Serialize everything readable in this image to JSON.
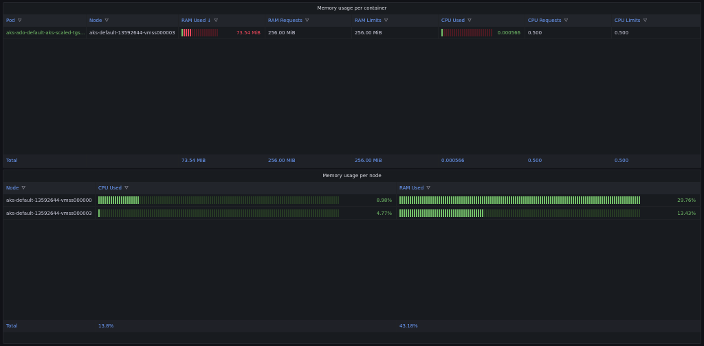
{
  "container_panel": {
    "title": "Memory usage per container",
    "columns": [
      "Pod",
      "Node",
      "RAM Used",
      "RAM Requests",
      "RAM Limits",
      "CPU Used",
      "CPU Requests",
      "CPU Limits"
    ],
    "sort_indicator": "↓",
    "rows": [
      {
        "pod": "aks-ado-default-aks-scaled-tgs...",
        "node": "aks-default-13592644-vmss000003",
        "ram_used": "73.54 MiB",
        "ram_used_fill": 0.29,
        "ram_requests": "256.00 MiB",
        "ram_limits": "256.00 MiB",
        "cpu_used": "0.000566",
        "cpu_used_fill": 0.01,
        "cpu_requests": "0.500",
        "cpu_limits": "0.500"
      }
    ],
    "total": {
      "label": "Total",
      "ram_used": "73.54 MiB",
      "ram_requests": "256.00 MiB",
      "ram_limits": "256.00 MiB",
      "cpu_used": "0.000566",
      "cpu_requests": "0.500",
      "cpu_limits": "0.500"
    }
  },
  "node_panel": {
    "title": "Memory usage per node",
    "columns": [
      "Node",
      "CPU Used",
      "RAM Used"
    ],
    "rows": [
      {
        "node": "aks-default-13592644-vmss000000",
        "cpu_used": "8.98%",
        "cpu_fill": 0.17,
        "ram_used": "29.76%",
        "ram_fill": 1.0
      },
      {
        "node": "aks-default-13592644-vmss000003",
        "cpu_used": "4.77%",
        "cpu_fill": 0.01,
        "ram_used": "13.43%",
        "ram_fill": 0.35
      }
    ],
    "total": {
      "label": "Total",
      "cpu_used": "13.8%",
      "ram_used": "43.18%"
    }
  },
  "colors": {
    "green": "#73bf69",
    "red": "#f2495c",
    "header_text": "#6e9fff",
    "pod_text": "#73bf69"
  },
  "icons": {
    "filter": "filter-icon",
    "sort": "sort-descending-icon"
  }
}
